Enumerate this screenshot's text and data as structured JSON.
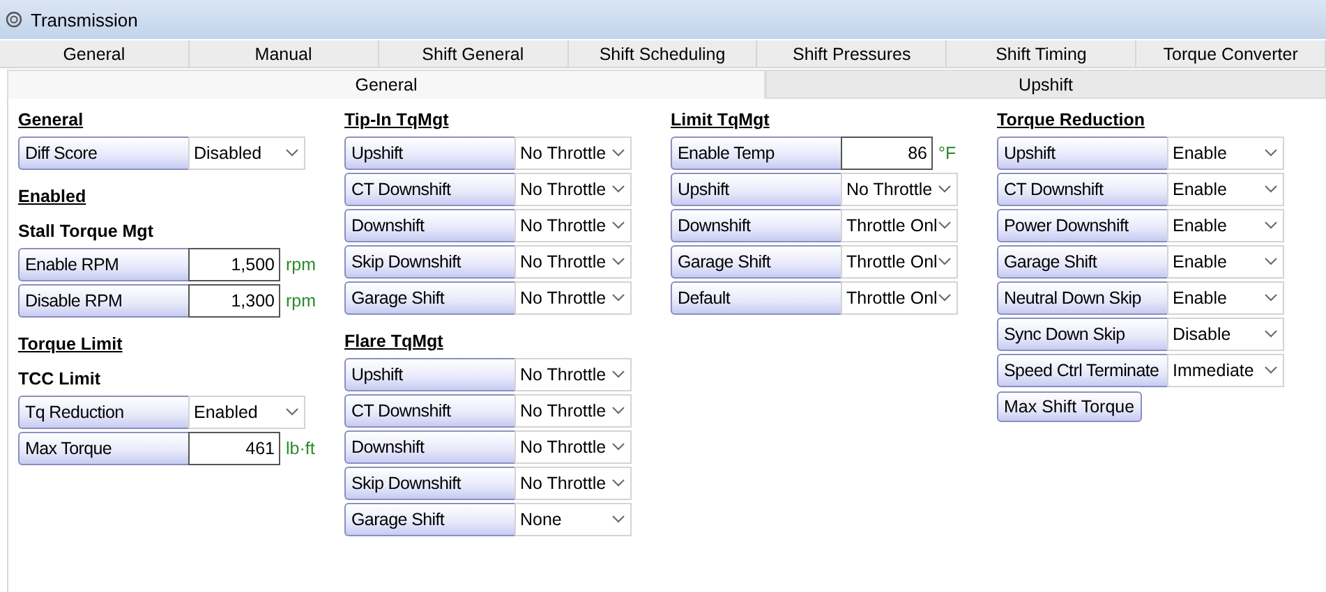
{
  "window": {
    "title": "Transmission"
  },
  "tabs": [
    {
      "label": "General"
    },
    {
      "label": "Manual"
    },
    {
      "label": "Shift General"
    },
    {
      "label": "Shift Scheduling"
    },
    {
      "label": "Shift Pressures"
    },
    {
      "label": "Shift Timing"
    },
    {
      "label": "Torque Converter"
    }
  ],
  "subtabs": [
    {
      "label": "General",
      "selected": true
    },
    {
      "label": "Upshift",
      "selected": false
    }
  ],
  "columns": [
    [
      {
        "kind": "heading",
        "text": "General"
      },
      {
        "kind": "select",
        "label": "Diff Score",
        "value": "Disabled"
      },
      {
        "kind": "heading",
        "text": "Enabled"
      },
      {
        "kind": "subheading",
        "text": "Stall Torque Mgt"
      },
      {
        "kind": "number",
        "label": "Enable RPM",
        "value": "1,500",
        "unit": "rpm"
      },
      {
        "kind": "number",
        "label": "Disable RPM",
        "value": "1,300",
        "unit": "rpm"
      },
      {
        "kind": "heading",
        "text": "Torque Limit"
      },
      {
        "kind": "subheading",
        "text": "TCC Limit"
      },
      {
        "kind": "select",
        "label": "Tq Reduction",
        "value": "Enabled"
      },
      {
        "kind": "number",
        "label": "Max Torque",
        "value": "461",
        "unit": "lb·ft"
      }
    ],
    [
      {
        "kind": "heading",
        "text": "Tip-In TqMgt"
      },
      {
        "kind": "select",
        "label": "Upshift",
        "value": "No Throttle"
      },
      {
        "kind": "select",
        "label": "CT Downshift",
        "value": "No Throttle"
      },
      {
        "kind": "select",
        "label": "Downshift",
        "value": "No Throttle"
      },
      {
        "kind": "select",
        "label": "Skip Downshift",
        "value": "No Throttle"
      },
      {
        "kind": "select",
        "label": "Garage Shift",
        "value": "No Throttle"
      },
      {
        "kind": "heading",
        "text": "Flare TqMgt"
      },
      {
        "kind": "select",
        "label": "Upshift",
        "value": "No Throttle"
      },
      {
        "kind": "select",
        "label": "CT Downshift",
        "value": "No Throttle"
      },
      {
        "kind": "select",
        "label": "Downshift",
        "value": "No Throttle"
      },
      {
        "kind": "select",
        "label": "Skip Downshift",
        "value": "No Throttle"
      },
      {
        "kind": "select",
        "label": "Garage Shift",
        "value": "None"
      }
    ],
    [
      {
        "kind": "heading",
        "text": "Limit TqMgt"
      },
      {
        "kind": "number",
        "label": "Enable Temp",
        "value": "86",
        "unit": "°F"
      },
      {
        "kind": "select",
        "label": "Upshift",
        "value": "No Throttle"
      },
      {
        "kind": "select",
        "label": "Downshift",
        "value": "Throttle Onl"
      },
      {
        "kind": "select",
        "label": "Garage Shift",
        "value": "Throttle Onl"
      },
      {
        "kind": "select",
        "label": "Default",
        "value": "Throttle Onl"
      }
    ],
    [
      {
        "kind": "heading",
        "text": "Torque Reduction"
      },
      {
        "kind": "select",
        "label": "Upshift",
        "value": "Enable"
      },
      {
        "kind": "select",
        "label": "CT Downshift",
        "value": "Enable"
      },
      {
        "kind": "select",
        "label": "Power Downshift",
        "value": "Enable"
      },
      {
        "kind": "select",
        "label": "Garage Shift",
        "value": "Enable"
      },
      {
        "kind": "select",
        "label": "Neutral Down Skip",
        "value": "Enable"
      },
      {
        "kind": "select",
        "label": "Sync Down Skip",
        "value": "Disable"
      },
      {
        "kind": "select",
        "label": "Speed Ctrl Terminate",
        "value": "Immediate"
      },
      {
        "kind": "button",
        "label": "Max Shift Torque"
      }
    ]
  ]
}
